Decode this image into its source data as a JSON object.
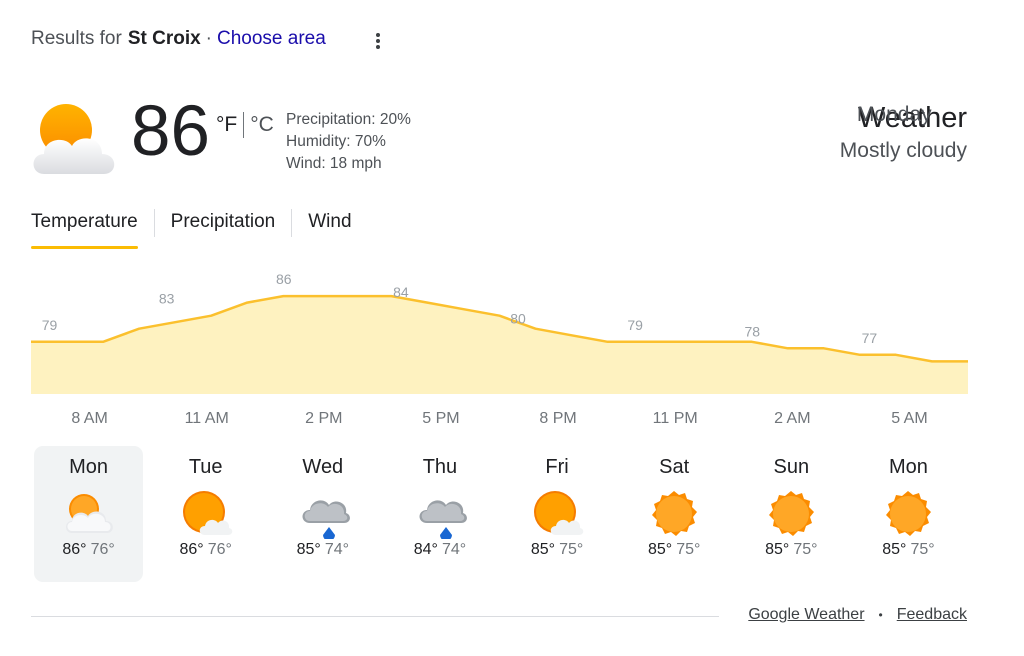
{
  "header": {
    "results_prefix": "Results for",
    "location": "St Croix",
    "separator": "·",
    "choose_area": "Choose area"
  },
  "current": {
    "icon": "partly-cloudy-icon",
    "temperature": "86",
    "unit_f": "°F",
    "unit_c": "°C",
    "precipitation": "Precipitation: 20%",
    "humidity": "Humidity: 70%",
    "wind": "Wind: 18 mph"
  },
  "summary": {
    "title": "Weather",
    "day": "Monday",
    "condition": "Mostly cloudy"
  },
  "tabs": [
    {
      "label": "Temperature",
      "active": true
    },
    {
      "label": "Precipitation",
      "active": false
    },
    {
      "label": "Wind",
      "active": false
    }
  ],
  "chart_data": {
    "type": "area",
    "x": [
      "8 AM",
      "11 AM",
      "2 PM",
      "5 PM",
      "8 PM",
      "11 PM",
      "2 AM",
      "5 AM"
    ],
    "values": [
      79,
      83,
      86,
      84,
      80,
      79,
      78,
      77
    ],
    "curve": [
      79,
      79,
      79,
      81,
      82,
      83,
      85,
      86,
      86,
      86,
      86,
      85,
      84,
      83,
      81,
      80,
      79,
      79,
      79,
      79,
      79,
      78,
      78,
      77,
      77,
      76,
      76
    ],
    "ylim": [
      71,
      90
    ],
    "colors": {
      "line": "#fbc02d",
      "fill": "#fef2c0",
      "label": "#9aa0a6"
    }
  },
  "forecast": [
    {
      "day": "Mon",
      "icon": "partly-cloudy-icon",
      "high": "86°",
      "low": "76°",
      "selected": true
    },
    {
      "day": "Tue",
      "icon": "sun-behind-cloud-icon",
      "high": "86°",
      "low": "76°",
      "selected": false
    },
    {
      "day": "Wed",
      "icon": "rain-cloud-icon",
      "high": "85°",
      "low": "74°",
      "selected": false
    },
    {
      "day": "Thu",
      "icon": "rain-cloud-icon",
      "high": "84°",
      "low": "74°",
      "selected": false
    },
    {
      "day": "Fri",
      "icon": "sun-behind-cloud-icon",
      "high": "85°",
      "low": "75°",
      "selected": false
    },
    {
      "day": "Sat",
      "icon": "sun-icon",
      "high": "85°",
      "low": "75°",
      "selected": false
    },
    {
      "day": "Sun",
      "icon": "sun-icon",
      "high": "85°",
      "low": "75°",
      "selected": false
    },
    {
      "day": "Mon",
      "icon": "sun-icon",
      "high": "85°",
      "low": "75°",
      "selected": false
    }
  ],
  "footer": {
    "source": "Google Weather",
    "separator": "•",
    "feedback": "Feedback"
  }
}
